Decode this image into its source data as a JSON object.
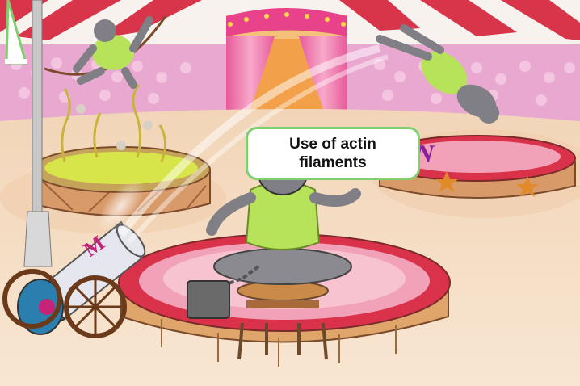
{
  "speech_bubble": {
    "text": "Use of actin filaments"
  },
  "colors": {
    "tent_red": "#d8344a",
    "tent_white": "#f7f2ee",
    "crowd_pink": "#e9a8d0",
    "ring_red": "#d9324a",
    "ring_pink": "#f2a2b8",
    "floor": "#f4dcc2",
    "vest_green": "#b7e35a",
    "gorilla_gray": "#7f7f85",
    "bubble_border": "#7fcf6e",
    "cannon_blue": "#2a7fae"
  },
  "icons": [
    "circus-tent",
    "gorilla",
    "cannon",
    "stool",
    "weight",
    "ring",
    "star"
  ]
}
